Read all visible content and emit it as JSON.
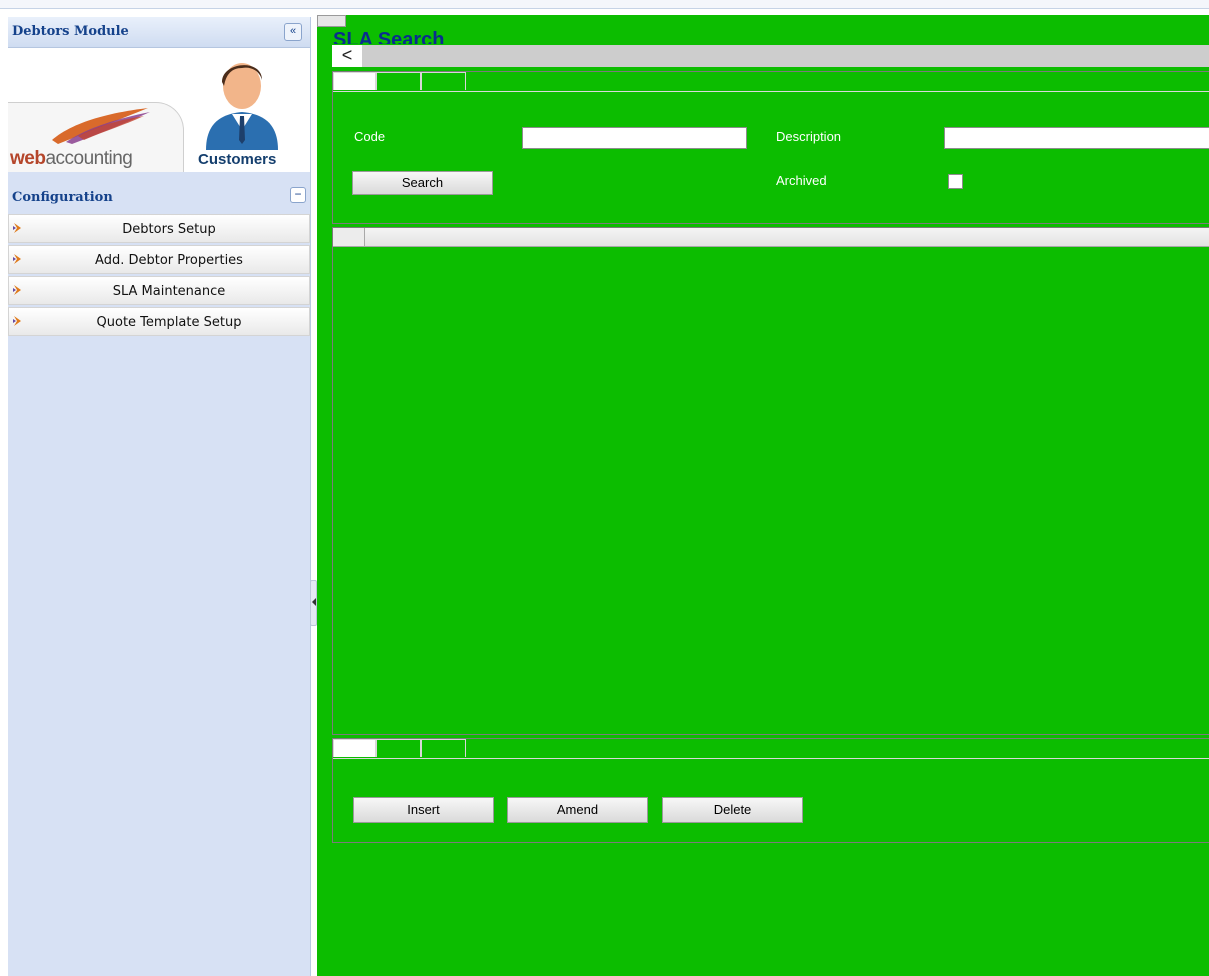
{
  "sidebar": {
    "title": "Debtors Module",
    "collapse_icon": "«",
    "logo": {
      "web": "web",
      "accounting": "accounting",
      "customers": "Customers"
    },
    "section_title": "Configuration",
    "section_toggle": "−",
    "items": [
      {
        "label": "Debtors Setup"
      },
      {
        "label": "Add. Debtor Properties"
      },
      {
        "label": "SLA Maintenance"
      },
      {
        "label": "Quote Template Setup"
      }
    ]
  },
  "main": {
    "title": "SLA Search",
    "back_icon": "<",
    "search": {
      "code_label": "Code",
      "code_value": "",
      "description_label": "Description",
      "description_value": "",
      "archived_label": "Archived",
      "archived_checked": false,
      "search_button": "Search"
    },
    "actions": {
      "insert": "Insert",
      "amend": "Amend",
      "delete": "Delete"
    }
  },
  "colors": {
    "main_background": "#0cbd00",
    "sidebar_background": "#d7e1f4",
    "heading_blue": "#15428b",
    "title_blue": "#0a2d8f"
  }
}
